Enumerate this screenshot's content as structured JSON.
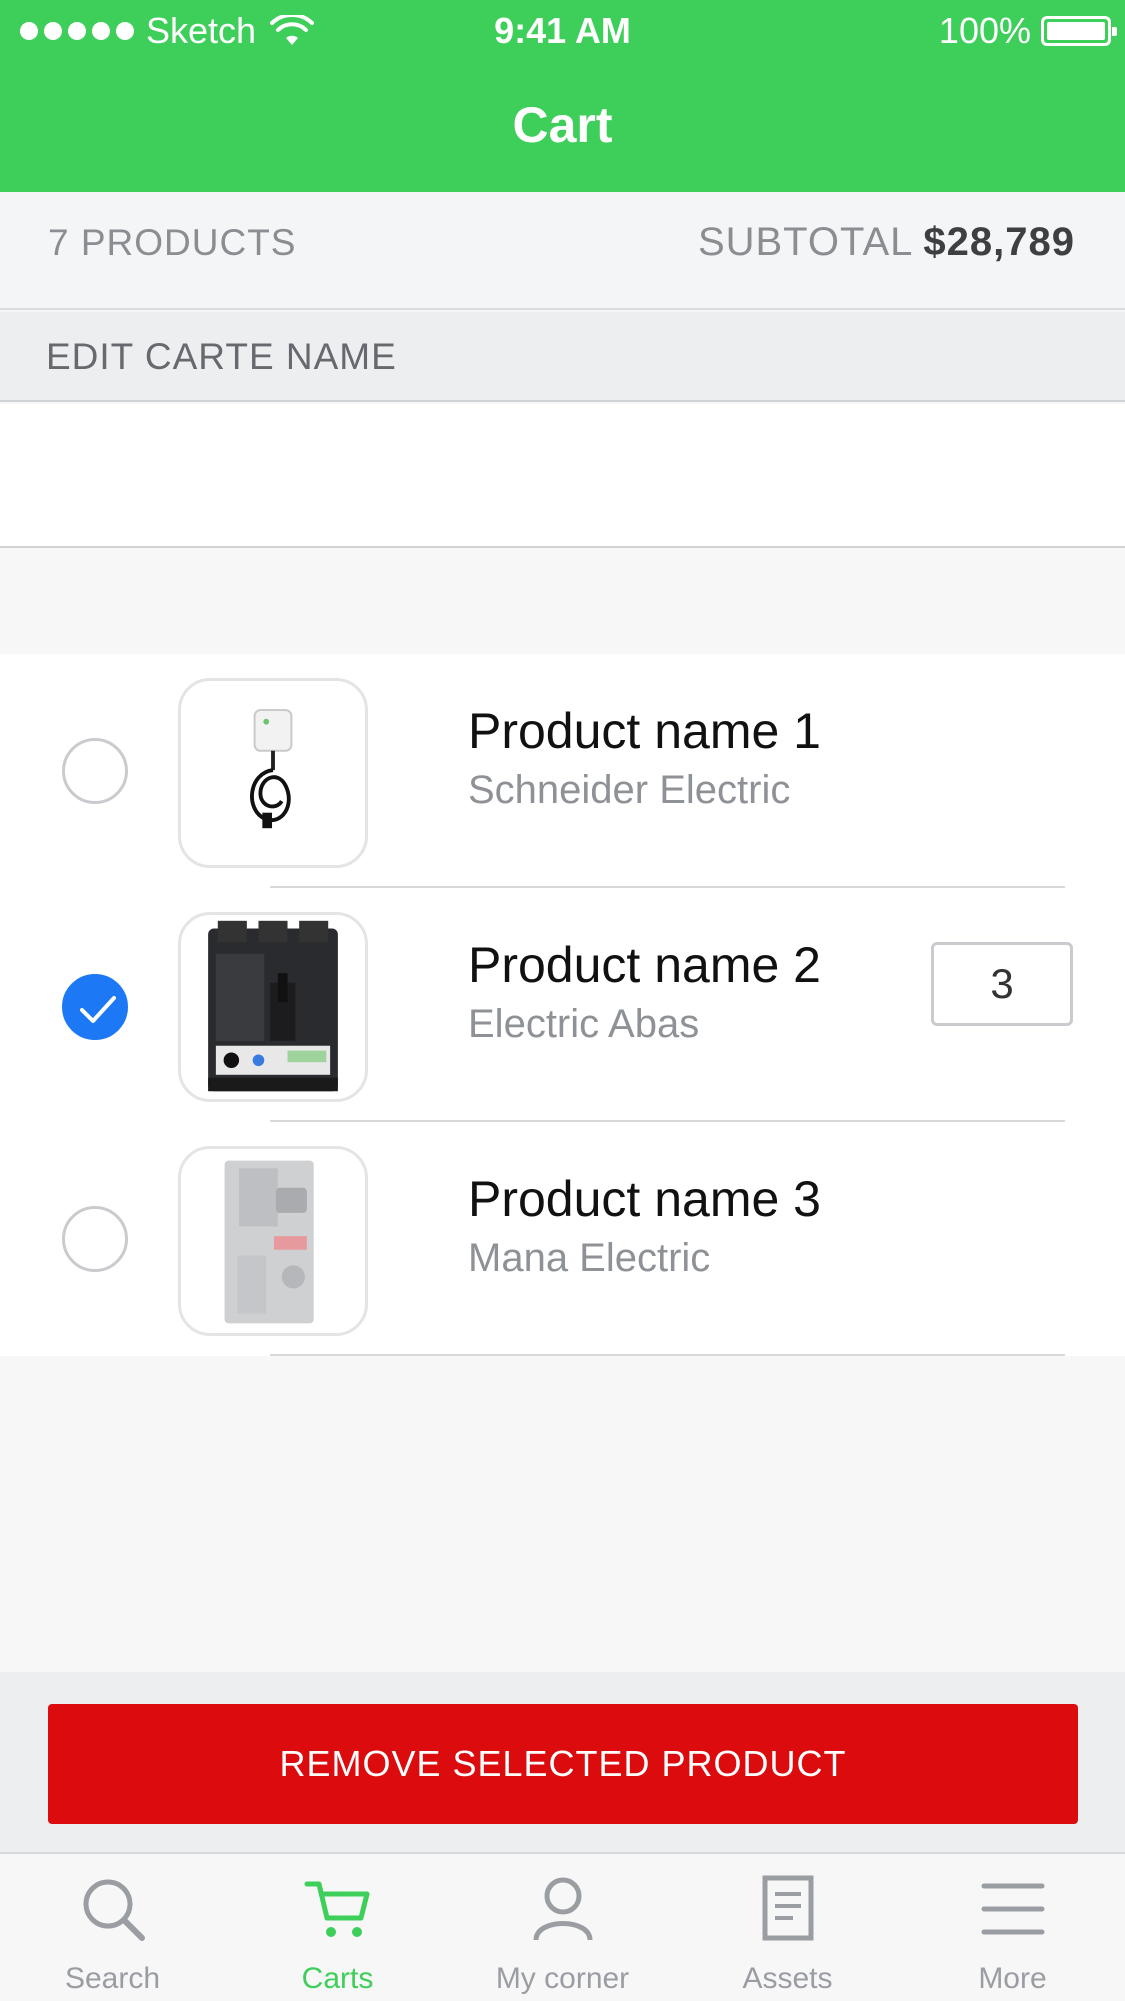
{
  "status_bar": {
    "carrier": "Sketch",
    "time": "9:41 AM",
    "battery": "100%"
  },
  "nav": {
    "title": "Cart"
  },
  "summary": {
    "products": "7 PRODUCTS",
    "subtotal_label": "SUBTOTAL",
    "subtotal_value": "$28,789"
  },
  "edit_section": {
    "title": "EDIT CARTE NAME",
    "value": "",
    "placeholder": ""
  },
  "products": [
    {
      "name": "Product name 1",
      "brand": "Schneider Electric",
      "selected": false,
      "image_icon": "ev-charger-icon"
    },
    {
      "name": "Product name 2",
      "brand": "Electric Abas",
      "selected": true,
      "quantity": "3",
      "image_icon": "circuit-breaker-icon"
    },
    {
      "name": "Product name 3",
      "brand": "Mana Electric",
      "selected": false,
      "image_icon": "breaker-module-icon"
    }
  ],
  "action": {
    "remove_label": "REMOVE SELECTED PRODUCT",
    "color": "#dc0b0d"
  },
  "tabs": [
    {
      "label": "Search",
      "icon": "search-icon",
      "active": false
    },
    {
      "label": "Carts",
      "icon": "cart-icon",
      "active": true
    },
    {
      "label": "My corner",
      "icon": "person-icon",
      "active": false
    },
    {
      "label": "Assets",
      "icon": "document-icon",
      "active": false
    },
    {
      "label": "More",
      "icon": "menu-icon",
      "active": false
    }
  ],
  "colors": {
    "brand": "#3ecf5a",
    "check": "#1c78f4"
  }
}
